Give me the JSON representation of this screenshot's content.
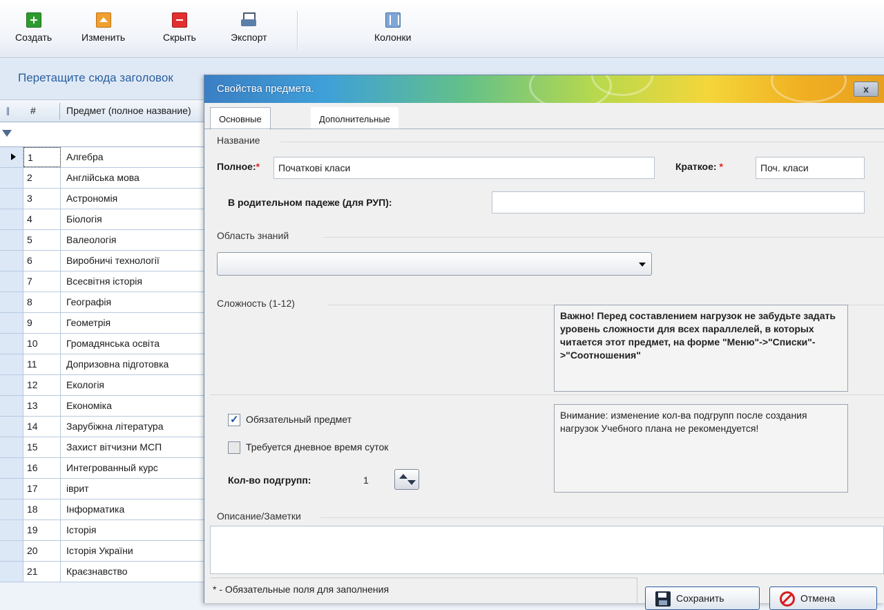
{
  "toolbar": {
    "buttons": [
      {
        "label": "Создать",
        "icon": "plus-icon"
      },
      {
        "label": "Изменить",
        "icon": "edit-icon"
      },
      {
        "label": "Скрыть",
        "icon": "hide-icon"
      },
      {
        "label": "Экспорт",
        "icon": "printer-icon"
      },
      {
        "label": "Колонки",
        "icon": "columns-icon"
      }
    ]
  },
  "grid": {
    "group_hint": "Перетащите сюда заголовок",
    "header": {
      "num": "#",
      "subject": "Предмет (полное название)"
    },
    "rows": [
      {
        "num": "1",
        "name": "Алгебра"
      },
      {
        "num": "2",
        "name": "Англійська мова"
      },
      {
        "num": "3",
        "name": "Астрономія"
      },
      {
        "num": "4",
        "name": "Біологія"
      },
      {
        "num": "5",
        "name": "Валеологія"
      },
      {
        "num": "6",
        "name": "Виробничі технології"
      },
      {
        "num": "7",
        "name": "Всесвітня історія"
      },
      {
        "num": "8",
        "name": "Географія"
      },
      {
        "num": "9",
        "name": "Геометрія"
      },
      {
        "num": "10",
        "name": "Громадянська освіта"
      },
      {
        "num": "11",
        "name": "Допризовна підготовка"
      },
      {
        "num": "12",
        "name": "Екологія"
      },
      {
        "num": "13",
        "name": "Економіка"
      },
      {
        "num": "14",
        "name": "Зарубіжна література"
      },
      {
        "num": "15",
        "name": "Захист вітчизни МСП"
      },
      {
        "num": "16",
        "name": "Интегрованный курс"
      },
      {
        "num": "17",
        "name": "іврит"
      },
      {
        "num": "18",
        "name": "Інформатика"
      },
      {
        "num": "19",
        "name": "Історія"
      },
      {
        "num": "20",
        "name": "Історія України"
      },
      {
        "num": "21",
        "name": "Краєзнавство"
      }
    ]
  },
  "dialog": {
    "title": "Свойства предмета.",
    "close_label": "x",
    "tabs": [
      {
        "label": "Основные",
        "active": true
      },
      {
        "label": "Дополнительные",
        "active": false
      }
    ],
    "name_section": "Название",
    "full_label": "Полное:",
    "full_value": "Початкові класи",
    "short_label": "Краткое:",
    "short_value": "Поч. класи",
    "genitive_label": "В родительном падеже (для РУП):",
    "genitive_value": "",
    "area_section": "Область знаний",
    "area_value": "",
    "complexity_section": "Сложность (1-12)",
    "complexity_note": "Важно! Перед составлением нагрузок не забудьте задать уровень сложности для всех параллелей, в которых читается этот предмет, на форме \"Меню\"->\"Списки\"->\"Соотношения\"",
    "mandatory_label": "Обязательный предмет",
    "mandatory_checked": true,
    "daytime_label": "Требуется дневное время суток",
    "daytime_checked": false,
    "subgroups_label": "Кол-во подгрупп:",
    "subgroups_value": "1",
    "subgroups_note": "Внимание: изменение кол-ва подгрупп после создания нагрузок Учебного плана не рекомендуется!",
    "notes_section": "Описание/Заметки",
    "notes_value": "",
    "required_note": "* - Обязательные поля для заполнения",
    "save_label": "Сохранить",
    "cancel_label": "Отмена"
  },
  "colors": {
    "accent": "#2a5f9e",
    "required": "#e02020",
    "titlebar_start": "#3b7fc4",
    "titlebar_end": "#e8a020"
  }
}
